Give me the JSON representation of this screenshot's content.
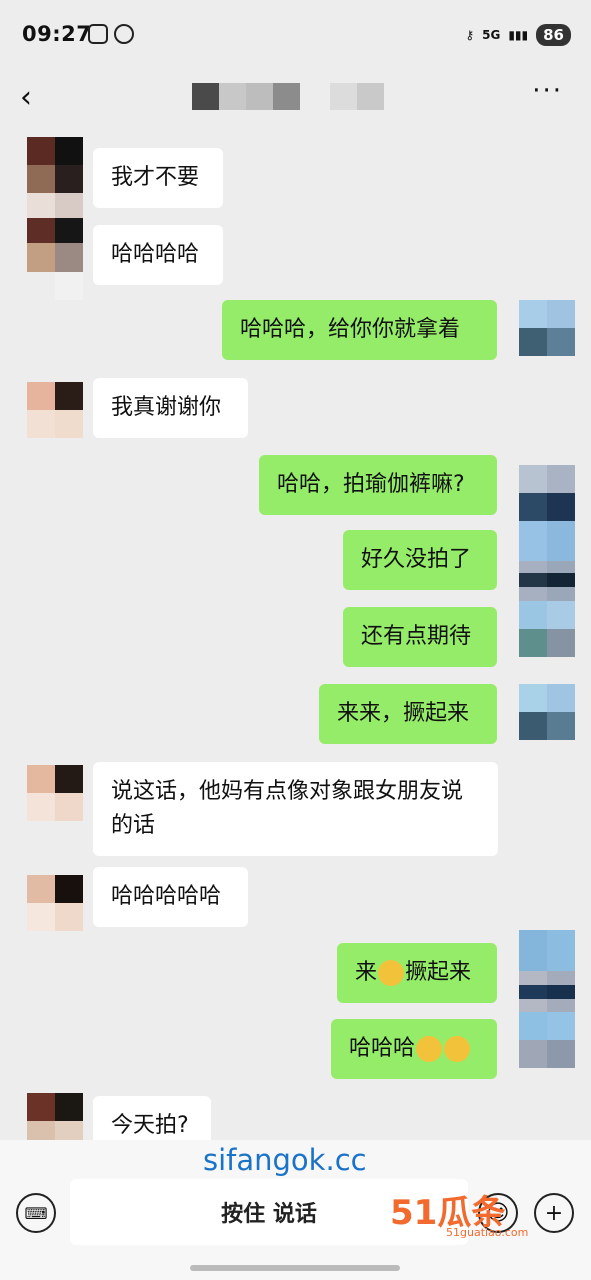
{
  "status_bar": {
    "time": "09:27",
    "network": "5G",
    "battery": "86"
  },
  "header": {
    "back_icon": "chevron-left-icon",
    "more_label": "···"
  },
  "messages": [
    {
      "side": "in",
      "text": "我才不要"
    },
    {
      "side": "in",
      "text": "哈哈哈哈"
    },
    {
      "side": "out",
      "text": "哈哈哈，给你你就拿着"
    },
    {
      "side": "in",
      "text": "我真谢谢你"
    },
    {
      "side": "out",
      "text": "哈哈，拍瑜伽裤嘛?"
    },
    {
      "side": "out",
      "text": "好久没拍了"
    },
    {
      "side": "out",
      "text": "还有点期待"
    },
    {
      "side": "out",
      "text": "来来，撅起来"
    },
    {
      "side": "in",
      "text": "说这话，他妈有点像对象跟女朋友说的话"
    },
    {
      "side": "in",
      "text": "哈哈哈哈哈"
    },
    {
      "side": "out",
      "text_before": "来",
      "emoji": "doge-emoji",
      "text_after": "撅起来"
    },
    {
      "side": "out",
      "text": "哈哈哈",
      "emoji": "laugh-cry-emoji"
    },
    {
      "side": "in",
      "text": "今天拍?"
    }
  ],
  "input_bar": {
    "hold_to_talk": "按住 说话",
    "keyboard_icon": "keyboard-icon",
    "emoji_icon": "smile-icon",
    "plus_icon": "plus-icon"
  },
  "watermarks": {
    "site": "sifangok.cc",
    "logo": "51瓜条",
    "logo_url": "51guatiao.com"
  }
}
